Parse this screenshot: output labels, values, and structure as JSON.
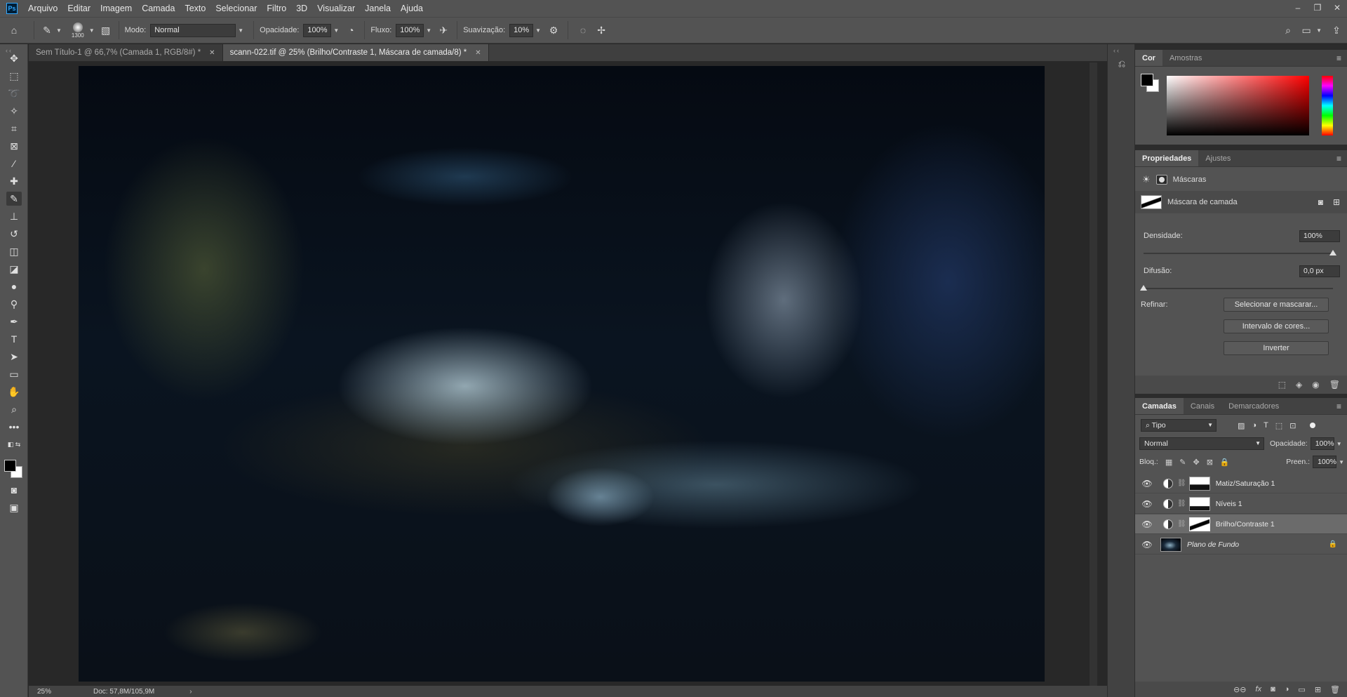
{
  "app": {
    "logo_text": "Ps"
  },
  "menu": [
    "Arquivo",
    "Editar",
    "Imagem",
    "Camada",
    "Texto",
    "Selecionar",
    "Filtro",
    "3D",
    "Visualizar",
    "Janela",
    "Ajuda"
  ],
  "window_controls": {
    "minimize": "–",
    "restore": "❐",
    "close": "✕"
  },
  "options": {
    "brush_size": "1300",
    "mode_label": "Modo:",
    "mode_value": "Normal",
    "opacity_label": "Opacidade:",
    "opacity_value": "100%",
    "flow_label": "Fluxo:",
    "flow_value": "100%",
    "smoothing_label": "Suavização:",
    "smoothing_value": "10%"
  },
  "tabs": [
    {
      "title": "Sem Título-1 @ 66,7% (Camada 1, RGB/8#) *",
      "close": "✕"
    },
    {
      "title": "scann-022.tif @ 25% (Brilho/Contraste 1, Máscara de camada/8) *",
      "close": "✕"
    }
  ],
  "status": {
    "zoom": "25%",
    "doc": "Doc: 57,8M/105,9M",
    "arrow": "›"
  },
  "color_panel": {
    "tabs": [
      "Cor",
      "Amostras"
    ],
    "menu": "≡"
  },
  "properties": {
    "tabs": [
      "Propriedades",
      "Ajustes"
    ],
    "menu": "≡",
    "section": "Máscaras",
    "mask_type": "Máscara de camada",
    "density_label": "Densidade:",
    "density_value": "100%",
    "density_level": 1.0,
    "feather_label": "Difusão:",
    "feather_value": "0,0 px",
    "feather_level": 0.0,
    "refine_label": "Refinar:",
    "buttons": [
      "Selecionar e mascarar...",
      "Intervalo de cores...",
      "Inverter"
    ]
  },
  "layers": {
    "tabs": [
      "Camadas",
      "Canais",
      "Demarcadores"
    ],
    "menu": "≡",
    "filter_value": "Tipo",
    "blend_mode": "Normal",
    "opacity_label": "Opacidade:",
    "opacity_value": "100%",
    "lock_label": "Bloq.:",
    "fill_label": "Preen.:",
    "fill_value": "100%",
    "items": [
      {
        "name": "Matiz/Saturação 1"
      },
      {
        "name": "Níveis 1"
      },
      {
        "name": "Brilho/Contraste 1"
      },
      {
        "name": "Plano de Fundo"
      }
    ],
    "footer_icons": [
      "link-icon",
      "fx-icon",
      "mask-icon",
      "adjustment-icon",
      "folder-icon",
      "new-layer-icon",
      "trash-icon"
    ],
    "footer_fx": "fx"
  },
  "colors": {
    "accent": "#31a8ff",
    "panel_bg": "#535353",
    "app_bg": "#282828"
  }
}
